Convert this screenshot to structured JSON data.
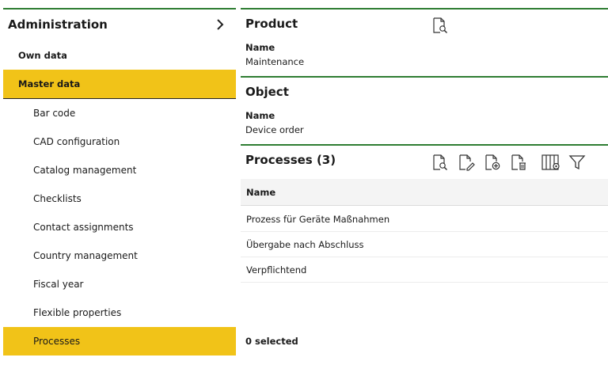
{
  "sidebar": {
    "title": "Administration",
    "items": [
      {
        "label": "Own data"
      },
      {
        "label": "Master data"
      },
      {
        "label": "Bar code"
      },
      {
        "label": "CAD configuration"
      },
      {
        "label": "Catalog management"
      },
      {
        "label": "Checklists"
      },
      {
        "label": "Contact assignments"
      },
      {
        "label": "Country management"
      },
      {
        "label": "Fiscal year"
      },
      {
        "label": "Flexible properties"
      },
      {
        "label": "Processes"
      }
    ],
    "active_items": [
      "Master data",
      "Processes"
    ]
  },
  "product": {
    "title": "Product",
    "name_label": "Name",
    "name_value": "Maintenance"
  },
  "object": {
    "title": "Object",
    "name_label": "Name",
    "name_value": "Device order"
  },
  "processes": {
    "title": "Processes (3)",
    "column_name": "Name",
    "rows": [
      {
        "name": "Prozess für Geräte Maßnahmen"
      },
      {
        "name": "Übergabe nach Abschluss"
      },
      {
        "name": "Verpflichtend"
      }
    ],
    "selected_text": "0 selected"
  },
  "colors": {
    "accent_green": "#2e7d32",
    "highlight_yellow": "#f1c318"
  },
  "icons": {
    "header": "chevron-right-icon",
    "product": "document-search-icon",
    "toolbar": [
      "document-search-icon",
      "document-edit-icon",
      "document-add-icon",
      "document-delete-icon",
      "column-settings-icon",
      "filter-icon"
    ]
  }
}
